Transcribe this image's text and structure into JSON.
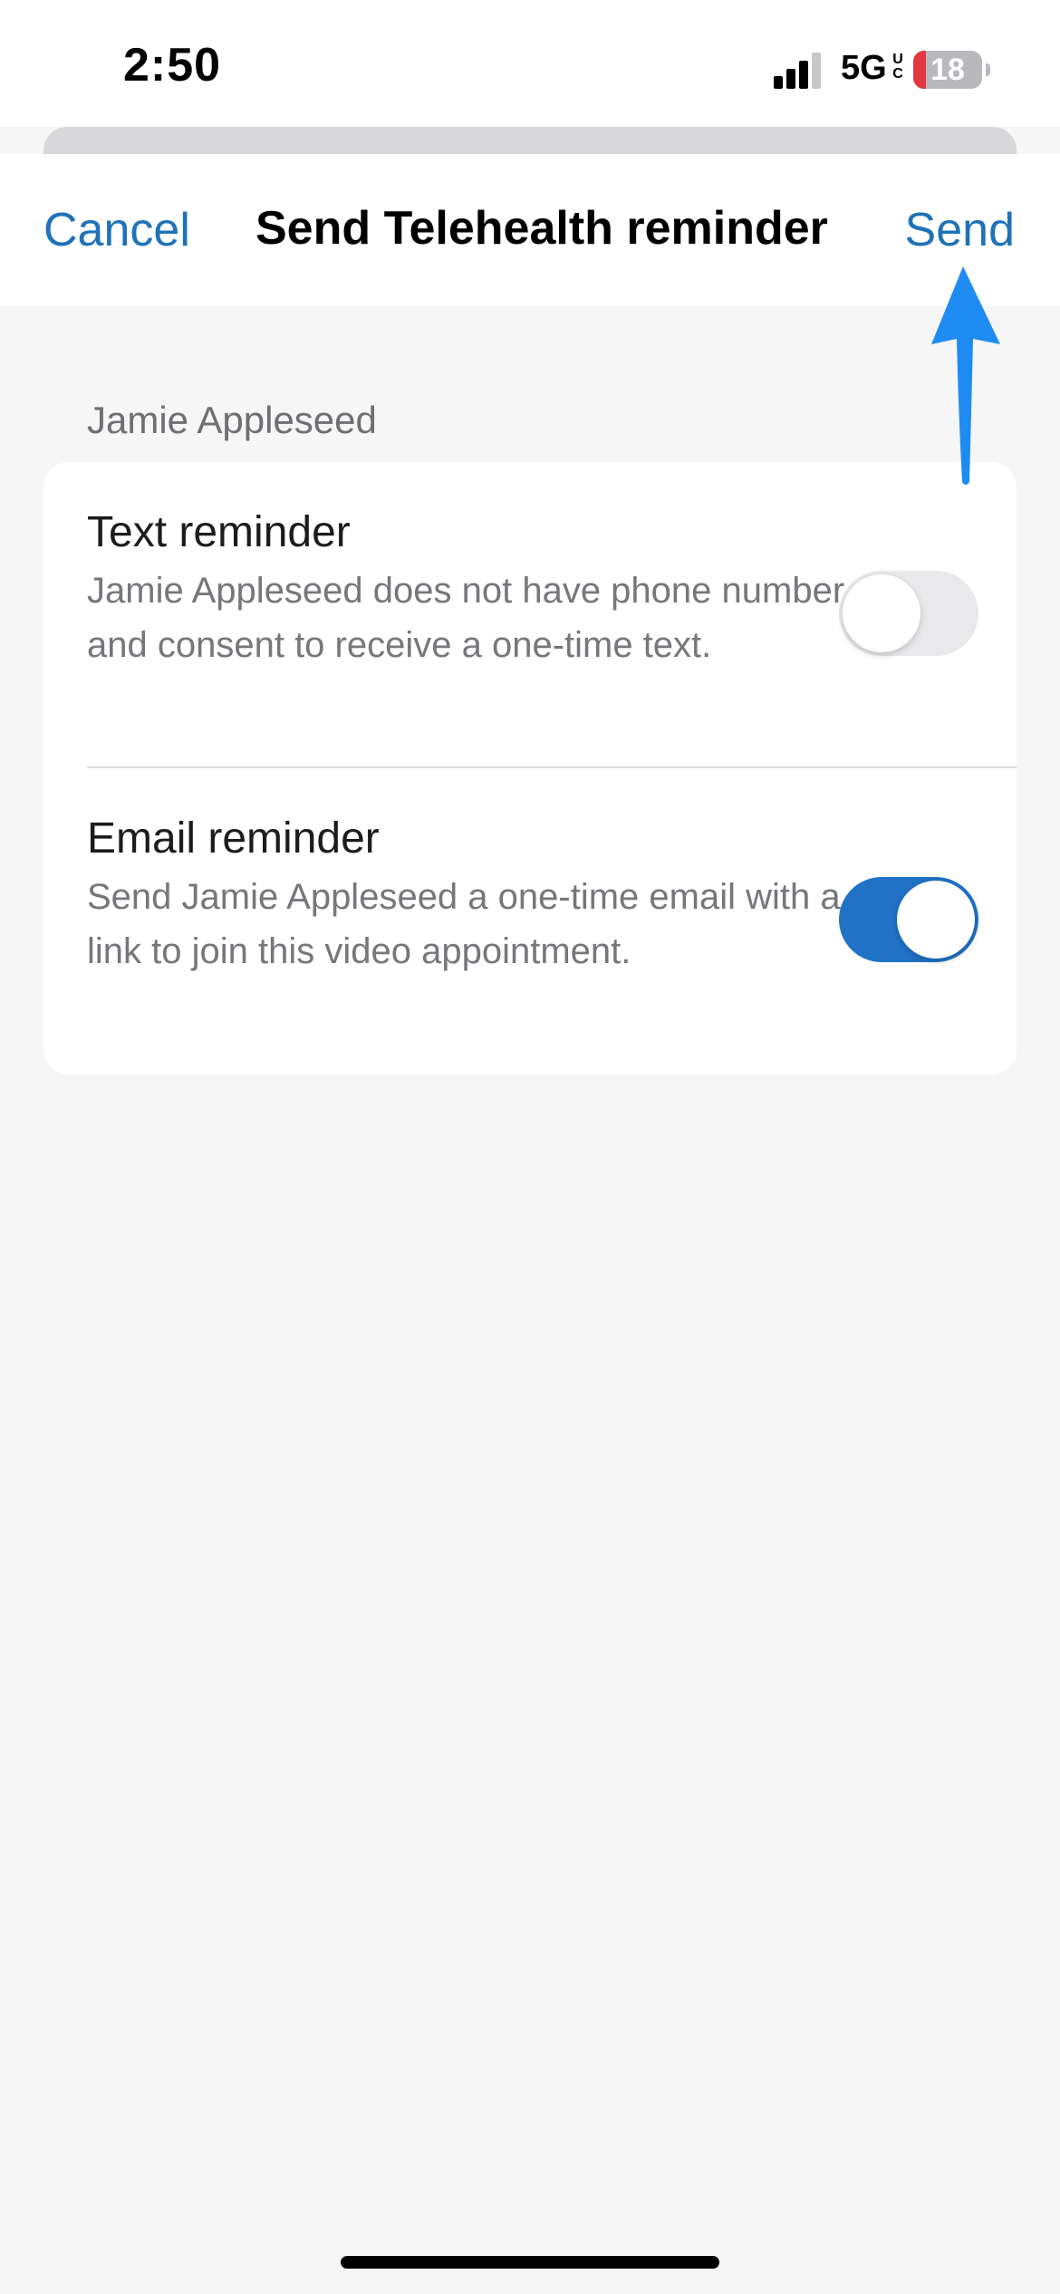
{
  "status_bar": {
    "time": "2:50",
    "network": "5G",
    "network_sup": "UC",
    "battery_level": 18,
    "battery_label": "18",
    "battery_low_color": "#e0383e"
  },
  "nav": {
    "cancel_label": "Cancel",
    "title": "Send Telehealth reminder",
    "send_label": "Send",
    "accent_color": "#1f72b8"
  },
  "patient": {
    "name": "Jamie Appleseed"
  },
  "options": [
    {
      "title": "Text reminder",
      "description": "Jamie Appleseed does not have phone number and consent to receive a one-time text.",
      "enabled": false
    },
    {
      "title": "Email reminder",
      "description": "Send Jamie Appleseed a one-time email with a link to join this video appointment.",
      "enabled": true
    }
  ],
  "annotation": {
    "icon": "arrow-up-icon",
    "color": "#1e8cf2",
    "points_to": "send-button"
  }
}
